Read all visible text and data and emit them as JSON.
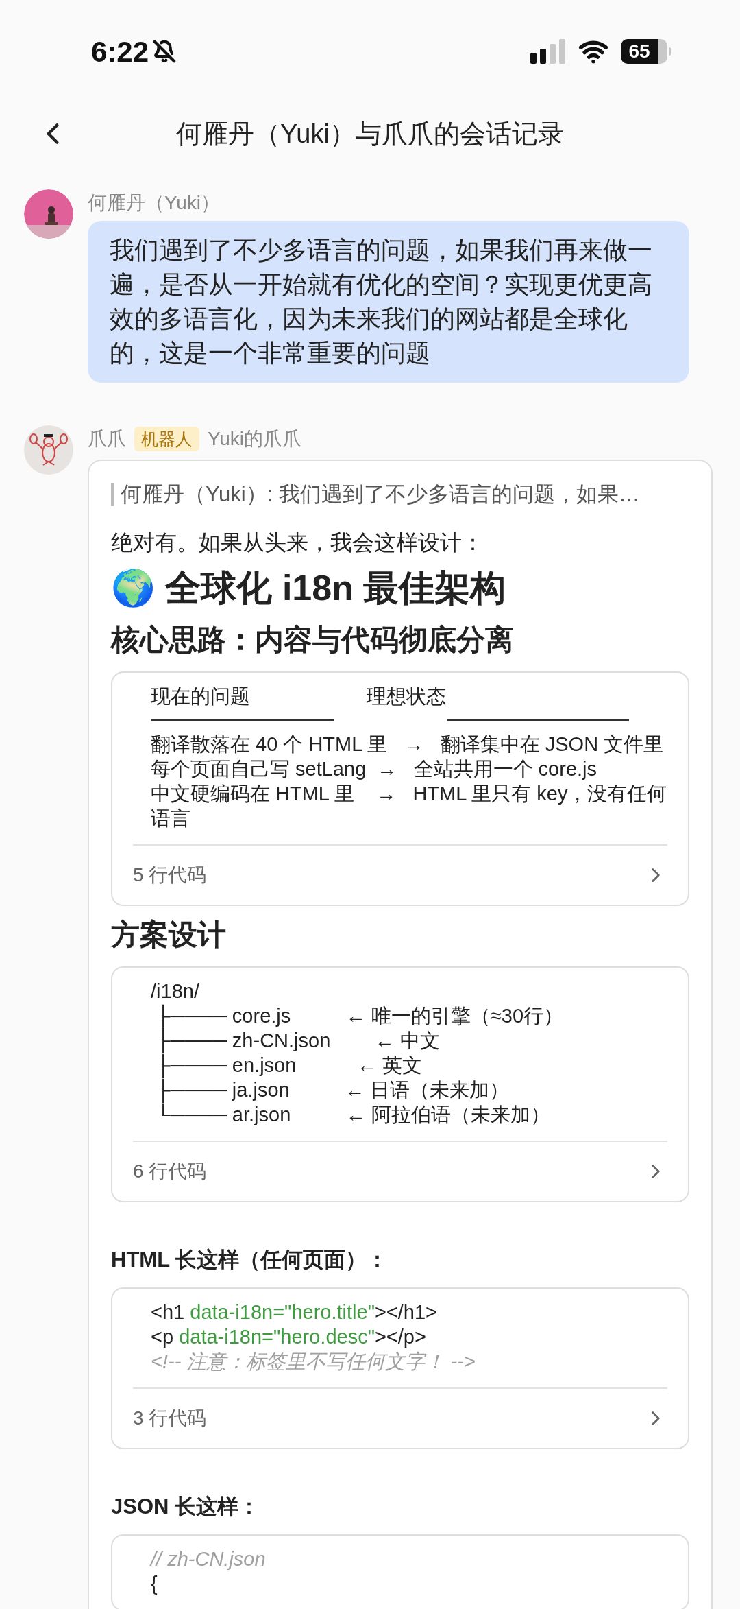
{
  "status_bar": {
    "time": "6:22",
    "battery": "65"
  },
  "header": {
    "title": "何雁丹（Yuki）与爪爪的会话记录"
  },
  "messages": [
    {
      "kind": "user",
      "sender": "何雁丹（Yuki）",
      "text": "我们遇到了不少多语言的问题，如果我们再来做一遍，是否从一开始就有优化的空间？实现更优更高效的多语言化，因为未来我们的网站都是全球化的，这是一个非常重要的问题"
    },
    {
      "kind": "bot",
      "sender": "爪爪",
      "badge": "机器人",
      "owner": "Yuki的爪爪",
      "quote": "何雁丹（Yuki）: 我们遇到了不少多语言的问题，如果…",
      "blocks": [
        {
          "kind": "paragraph",
          "text": "绝对有。如果从头来，我会这样设计："
        },
        {
          "kind": "h1",
          "text": "🌍 全球化 i18n 最佳架构"
        },
        {
          "kind": "h2",
          "text": "核心思路：内容与代码彻底分离"
        },
        {
          "kind": "code",
          "footer": "5 行代码",
          "lines": [
            {
              "kind": "header",
              "cells": [
                "现在的问题",
                "理想状态"
              ]
            },
            {
              "kind": "text",
              "text": "翻译散落在 40 个 HTML 里   →   翻译集中在 JSON 文件里"
            },
            {
              "kind": "text",
              "text": "每个页面自己写 setLang  →   全站共用一个 core.js"
            },
            {
              "kind": "text",
              "text": "中文硬编码在 HTML 里    →   HTML 里只有 key，没有任何语言"
            }
          ]
        },
        {
          "kind": "h2",
          "text": "方案设计"
        },
        {
          "kind": "code",
          "footer": "6 行代码",
          "lines": [
            {
              "kind": "text",
              "text": "/i18n/"
            },
            {
              "kind": "text",
              "text": " ├──── core.js          ← 唯一的引擎（≈30行）"
            },
            {
              "kind": "text",
              "text": " ├──── zh-CN.json        ← 中文"
            },
            {
              "kind": "text",
              "text": " ├──── en.json           ← 英文"
            },
            {
              "kind": "text",
              "text": " ├──── ja.json          ← 日语（未来加）"
            },
            {
              "kind": "text",
              "text": " └──── ar.json          ← 阿拉伯语（未来加）"
            }
          ]
        },
        {
          "kind": "h3",
          "text": "HTML 长这样（任何页面）："
        },
        {
          "kind": "code",
          "footer": "3 行代码",
          "lines": [
            {
              "kind": "code",
              "segments": [
                {
                  "kind": "tag",
                  "text": "<h1 "
                },
                {
                  "kind": "attr",
                  "text": "data-i18n=\"hero.title\""
                },
                {
                  "kind": "tag",
                  "text": "></h1>"
                }
              ]
            },
            {
              "kind": "code",
              "segments": [
                {
                  "kind": "tag",
                  "text": "<p "
                },
                {
                  "kind": "attr",
                  "text": "data-i18n=\"hero.desc\""
                },
                {
                  "kind": "tag",
                  "text": "></p>"
                }
              ]
            },
            {
              "kind": "comment",
              "text": "<!-- 注意：标签里不写任何文字！ -->"
            }
          ]
        },
        {
          "kind": "h3",
          "text": "JSON 长这样："
        },
        {
          "kind": "code",
          "lines": [
            {
              "kind": "comment",
              "text": "// zh-CN.json"
            },
            {
              "kind": "text",
              "text": "{"
            }
          ]
        }
      ]
    }
  ]
}
